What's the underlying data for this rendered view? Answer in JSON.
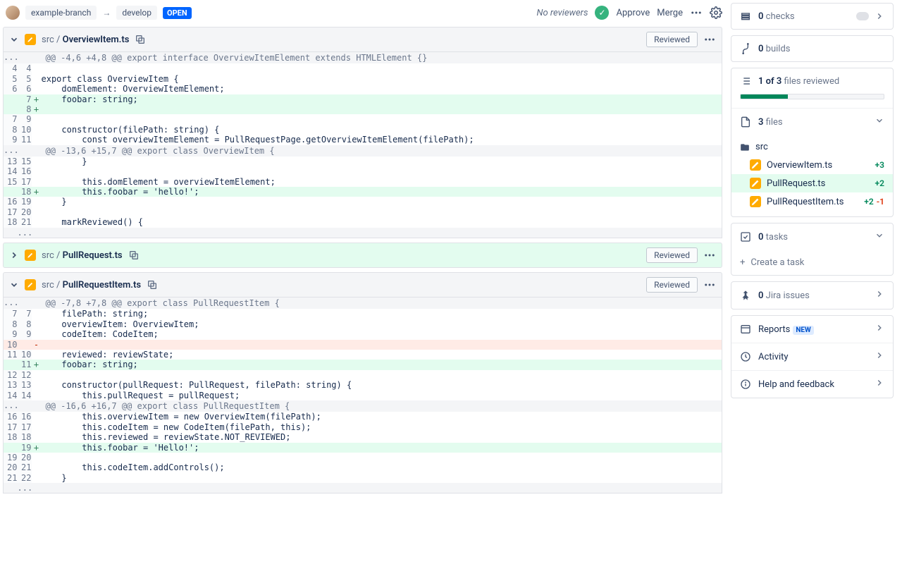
{
  "header": {
    "source_branch": "example-branch",
    "target_branch": "develop",
    "status": "OPEN",
    "no_reviewers": "No reviewers",
    "approve": "Approve",
    "merge": "Merge"
  },
  "files": [
    {
      "dir": "src /",
      "name": "OverviewItem.ts",
      "expanded": true,
      "green": false,
      "reviewed_label": "Reviewed",
      "lines": [
        {
          "type": "hunk",
          "old": "...",
          "new": "",
          "text": "@@ -4,6 +4,8 @@ export interface OverviewItemElement extends HTMLElement {}"
        },
        {
          "type": "ctx",
          "old": "4",
          "new": "4",
          "text": ""
        },
        {
          "type": "ctx",
          "old": "5",
          "new": "5",
          "text": "export class OverviewItem {"
        },
        {
          "type": "ctx",
          "old": "6",
          "new": "6",
          "text": "    domElement: OverviewItemElement;"
        },
        {
          "type": "add",
          "old": "",
          "new": "7",
          "text": "    foobar: string;"
        },
        {
          "type": "add",
          "old": "",
          "new": "8",
          "text": ""
        },
        {
          "type": "ctx",
          "old": "7",
          "new": "9",
          "text": ""
        },
        {
          "type": "ctx",
          "old": "8",
          "new": "10",
          "text": "    constructor(filePath: string) {"
        },
        {
          "type": "ctx",
          "old": "9",
          "new": "11",
          "text": "        const overviewItemElement = PullRequestPage.getOverviewItemElement(filePath);"
        },
        {
          "type": "hunk",
          "old": "...",
          "new": "",
          "text": "@@ -13,6 +15,7 @@ export class OverviewItem {"
        },
        {
          "type": "ctx",
          "old": "13",
          "new": "15",
          "text": "        }"
        },
        {
          "type": "ctx",
          "old": "14",
          "new": "16",
          "text": ""
        },
        {
          "type": "ctx",
          "old": "15",
          "new": "17",
          "text": "        this.domElement = overviewItemElement;"
        },
        {
          "type": "add",
          "old": "",
          "new": "18",
          "text": "        this.foobar = 'hello!';"
        },
        {
          "type": "ctx",
          "old": "16",
          "new": "19",
          "text": "    }"
        },
        {
          "type": "ctx",
          "old": "17",
          "new": "20",
          "text": ""
        },
        {
          "type": "ctx",
          "old": "18",
          "new": "21",
          "text": "    markReviewed() {"
        },
        {
          "type": "hunk",
          "old": "",
          "new": "...",
          "text": ""
        }
      ]
    },
    {
      "dir": "src /",
      "name": "PullRequest.ts",
      "expanded": false,
      "green": true,
      "reviewed_label": "Reviewed"
    },
    {
      "dir": "src /",
      "name": "PullRequestItem.ts",
      "expanded": true,
      "green": false,
      "reviewed_label": "Reviewed",
      "lines": [
        {
          "type": "hunk",
          "old": "...",
          "new": "",
          "text": "@@ -7,8 +7,8 @@ export class PullRequestItem {"
        },
        {
          "type": "ctx",
          "old": "7",
          "new": "7",
          "text": "    filePath: string;"
        },
        {
          "type": "ctx",
          "old": "8",
          "new": "8",
          "text": "    overviewItem: OverviewItem;"
        },
        {
          "type": "ctx",
          "old": "9",
          "new": "9",
          "text": "    codeItem: CodeItem;"
        },
        {
          "type": "del",
          "old": "10",
          "new": "",
          "text": ""
        },
        {
          "type": "ctx",
          "old": "11",
          "new": "10",
          "text": "    reviewed: reviewState;"
        },
        {
          "type": "add",
          "old": "",
          "new": "11",
          "text": "    foobar: string;"
        },
        {
          "type": "ctx",
          "old": "12",
          "new": "12",
          "text": ""
        },
        {
          "type": "ctx",
          "old": "13",
          "new": "13",
          "text": "    constructor(pullRequest: PullRequest, filePath: string) {"
        },
        {
          "type": "ctx",
          "old": "14",
          "new": "14",
          "text": "        this.pullRequest = pullRequest;"
        },
        {
          "type": "hunk",
          "old": "...",
          "new": "",
          "text": "@@ -16,6 +16,7 @@ export class PullRequestItem {"
        },
        {
          "type": "ctx",
          "old": "16",
          "new": "16",
          "text": "        this.overviewItem = new OverviewItem(filePath);"
        },
        {
          "type": "ctx",
          "old": "17",
          "new": "17",
          "text": "        this.codeItem = new CodeItem(filePath, this);"
        },
        {
          "type": "ctx",
          "old": "18",
          "new": "18",
          "text": "        this.reviewed = reviewState.NOT_REVIEWED;"
        },
        {
          "type": "add",
          "old": "",
          "new": "19",
          "text": "        this.foobar = 'Hello!';"
        },
        {
          "type": "ctx",
          "old": "19",
          "new": "20",
          "text": ""
        },
        {
          "type": "ctx",
          "old": "20",
          "new": "21",
          "text": "        this.codeItem.addControls();"
        },
        {
          "type": "ctx",
          "old": "21",
          "new": "22",
          "text": "    }"
        },
        {
          "type": "hunk",
          "old": "",
          "new": "...",
          "text": ""
        }
      ]
    }
  ],
  "sidebar": {
    "checks": {
      "count": "0",
      "label": "checks"
    },
    "builds": {
      "count": "0",
      "label": "builds"
    },
    "reviewed": {
      "text_before": "1 of 3",
      "text_after": "files reviewed",
      "percent": 33
    },
    "files_header": {
      "count": "3",
      "label": "files"
    },
    "tree_root": "src",
    "tree": [
      {
        "name": "OverviewItem.ts",
        "plus": "+3",
        "minus": "",
        "active": false
      },
      {
        "name": "PullRequest.ts",
        "plus": "+2",
        "minus": "",
        "active": true
      },
      {
        "name": "PullRequestItem.ts",
        "plus": "+2",
        "minus": "-1",
        "active": false
      }
    ],
    "tasks": {
      "count": "0",
      "label": "tasks"
    },
    "create_task": "Create a task",
    "jira": {
      "count": "0",
      "label": "Jira issues"
    },
    "reports": "Reports",
    "reports_badge": "NEW",
    "activity": "Activity",
    "help": "Help and feedback"
  }
}
